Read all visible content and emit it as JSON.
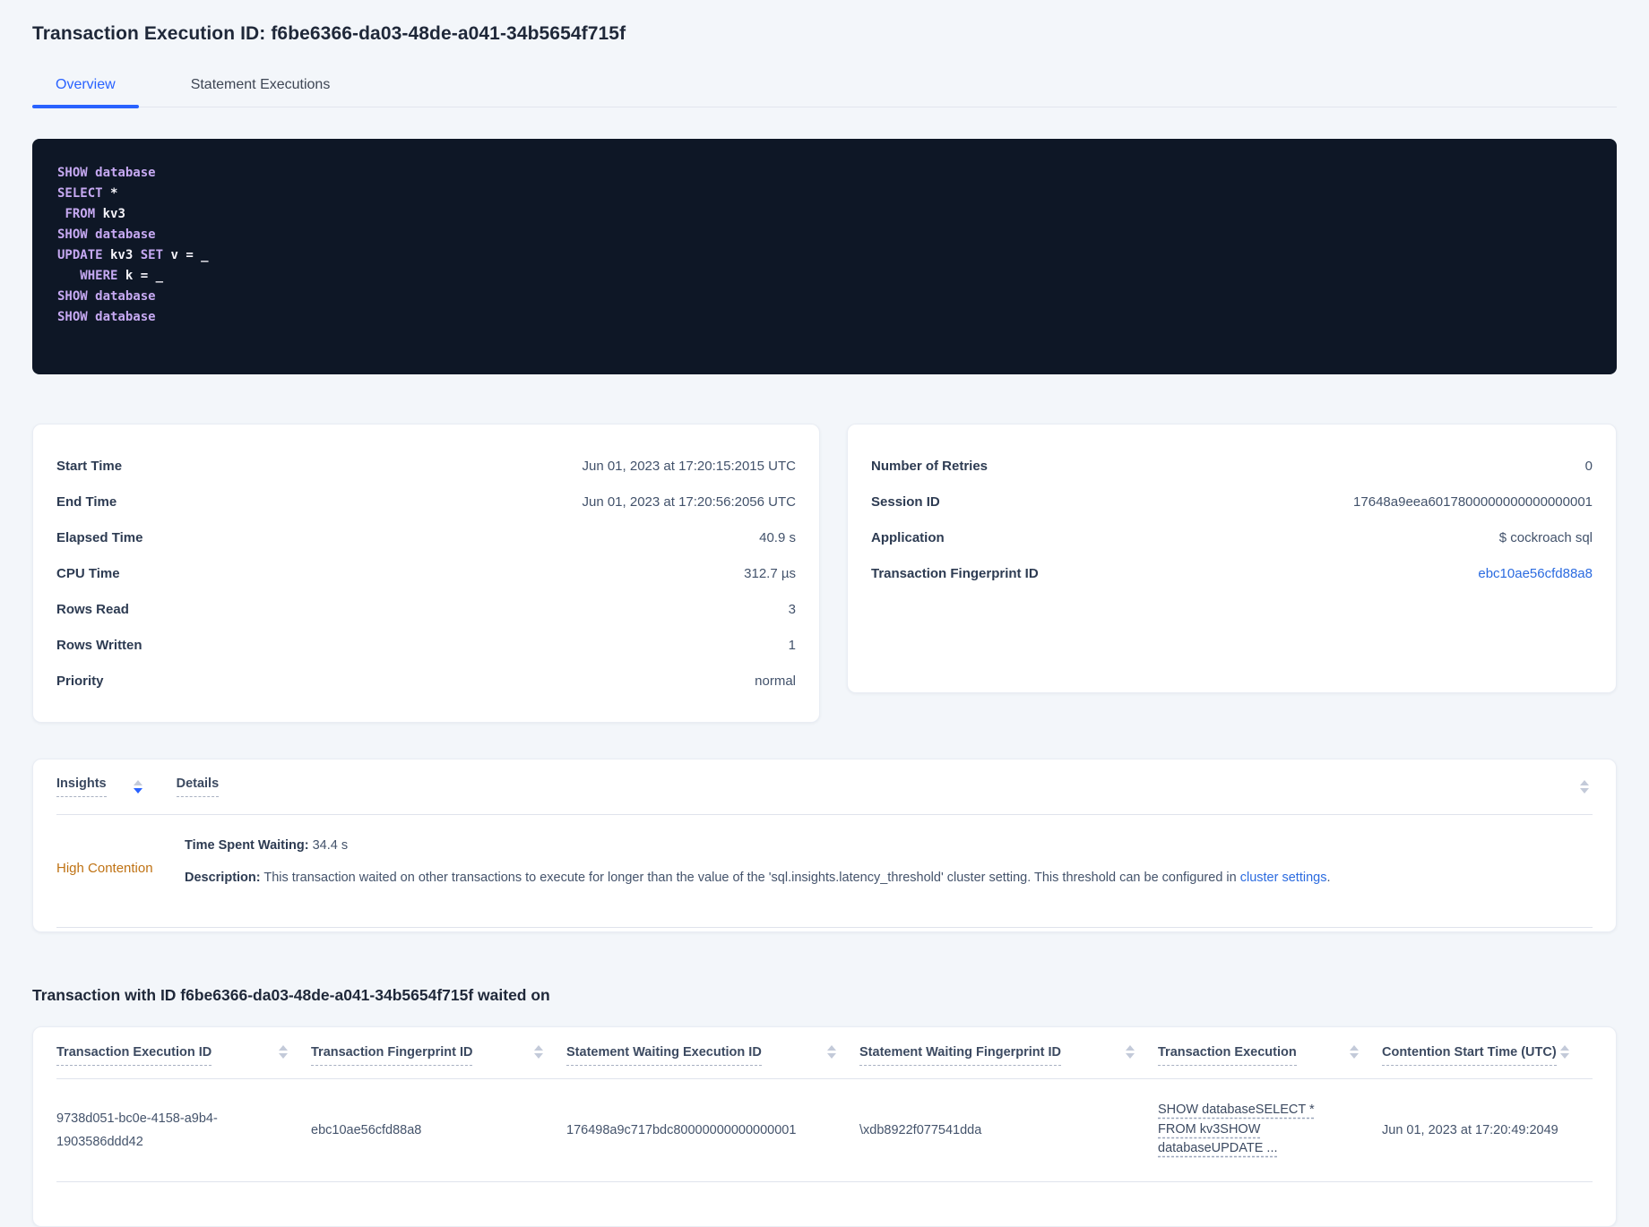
{
  "page": {
    "title": "Transaction Execution ID: f6be6366-da03-48de-a041-34b5654f715f"
  },
  "tabs": {
    "overview": "Overview",
    "statement_executions": "Statement Executions"
  },
  "colors": {
    "accent_blue": "#2962ff",
    "link_blue": "#2b6be0",
    "warning_orange": "#bf7213",
    "code_background": "#0e1726",
    "code_keyword": "#c6a9f2",
    "code_plain": "#f5f4fa",
    "page_background": "#f3f6fa"
  },
  "sql": {
    "lines": [
      {
        "tokens": [
          {
            "x": "SHOW database",
            "c": "kw"
          }
        ]
      },
      {
        "tokens": [
          {
            "x": "SELECT",
            "c": "kw"
          },
          {
            "x": " *",
            "c": "pl"
          }
        ]
      },
      {
        "tokens": [
          {
            "x": " ",
            "c": "pl"
          },
          {
            "x": "FROM",
            "c": "kw"
          },
          {
            "x": " kv3",
            "c": "pl"
          }
        ]
      },
      {
        "tokens": [
          {
            "x": "SHOW database",
            "c": "kw"
          }
        ]
      },
      {
        "tokens": [
          {
            "x": "UPDATE",
            "c": "kw"
          },
          {
            "x": " kv3 ",
            "c": "pl"
          },
          {
            "x": "SET",
            "c": "kw"
          },
          {
            "x": " v = _",
            "c": "pl"
          }
        ]
      },
      {
        "tokens": [
          {
            "x": "   ",
            "c": "pl"
          },
          {
            "x": "WHERE",
            "c": "kw"
          },
          {
            "x": " k = _",
            "c": "pl"
          }
        ]
      },
      {
        "tokens": [
          {
            "x": "SHOW database",
            "c": "kw"
          }
        ]
      },
      {
        "tokens": [
          {
            "x": "SHOW database",
            "c": "kw"
          }
        ]
      }
    ]
  },
  "summary": {
    "rows": [
      {
        "label": "Start Time",
        "value": "Jun 01, 2023 at 17:20:15:2015 UTC"
      },
      {
        "label": "End Time",
        "value": "Jun 01, 2023 at 17:20:56:2056 UTC"
      },
      {
        "label": "Elapsed Time",
        "value": "40.9 s"
      },
      {
        "label": "CPU Time",
        "value": "312.7 µs"
      },
      {
        "label": "Rows Read",
        "value": "3"
      },
      {
        "label": "Rows Written",
        "value": "1"
      },
      {
        "label": "Priority",
        "value": "normal"
      }
    ]
  },
  "session": {
    "rows": [
      {
        "label": "Number of Retries",
        "value": "0"
      },
      {
        "label": "Session ID",
        "value": "17648a9eea6017800000000000000001"
      },
      {
        "label": "Application",
        "value": "$ cockroach sql"
      }
    ],
    "fingerprint": {
      "label": "Transaction Fingerprint ID",
      "value": "ebc10ae56cfd88a8"
    }
  },
  "insights": {
    "headers": {
      "insights": "Insights",
      "details": "Details"
    },
    "row": {
      "insight": "High Contention",
      "waiting_label": "Time Spent Waiting:",
      "waiting_value": " 34.4 s",
      "description_label": "Description:",
      "description_text": " This transaction waited on other transactions to execute for longer than the value of the 'sql.insights.latency_threshold' cluster setting. This threshold can be configured in ",
      "description_link": "cluster settings",
      "description_suffix": "."
    }
  },
  "waited_on": {
    "heading": "Transaction with ID f6be6366-da03-48de-a041-34b5654f715f waited on",
    "columns": [
      "Transaction Execution ID",
      "Transaction Fingerprint ID",
      "Statement Waiting Execution ID",
      "Statement Waiting Fingerprint ID",
      "Transaction Execution",
      "Contention Start Time (UTC)"
    ],
    "row": {
      "transaction_execution_id": "9738d051-bc0e-4158-a9b4-1903586ddd42",
      "transaction_fingerprint_id": "ebc10ae56cfd88a8",
      "statement_waiting_execution_id": "176498a9c717bdc80000000000000001",
      "statement_waiting_fingerprint_id": "\\xdb8922f077541dda",
      "transaction_execution": "SHOW databaseSELECT * FROM kv3SHOW databaseUPDATE ...",
      "contention_start_time": "Jun 01, 2023 at 17:20:49:2049"
    }
  }
}
